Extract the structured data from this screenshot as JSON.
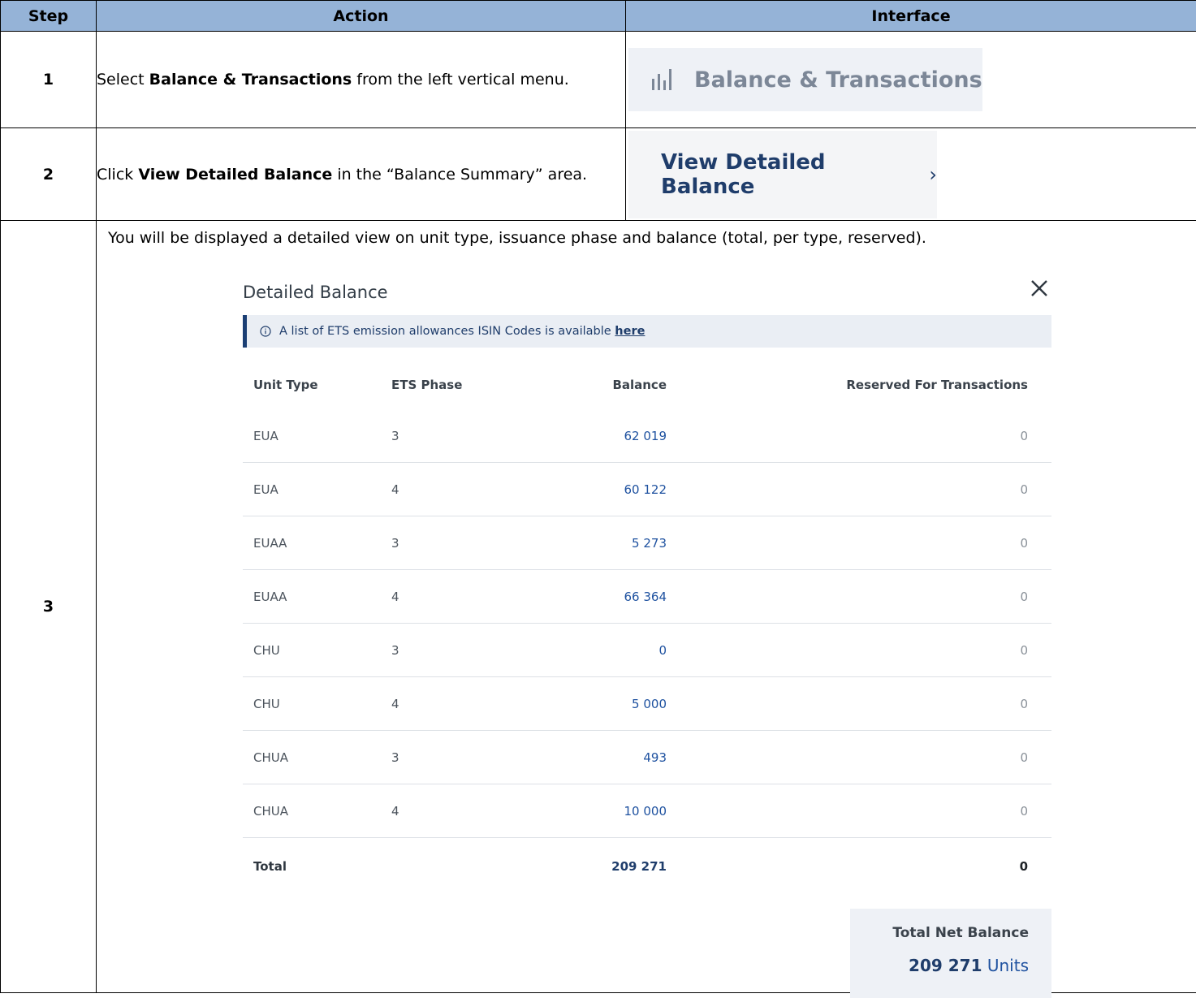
{
  "table": {
    "headers": [
      "Step",
      "Action",
      "Interface"
    ],
    "steps": [
      {
        "number": "1",
        "action_pre": "Select ",
        "action_bold": "Balance & Transactions",
        "action_post": " from the left vertical menu.",
        "interface_label": "Balance & Transactions",
        "interface_icon": "bar-chart-icon"
      },
      {
        "number": "2",
        "action_pre": "Click ",
        "action_bold": "View Detailed Balance",
        "action_post": " in the “Balance Summary” area.",
        "interface_label": "View Detailed Balance",
        "interface_icon": "chevron-right-icon"
      },
      {
        "number": "3",
        "intro": "You will be displayed a detailed view on unit type, issuance phase and balance (total, per type, reserved)."
      }
    ]
  },
  "detailed_balance": {
    "title": "Detailed Balance",
    "info_text": "A list of ETS emission allowances ISIN Codes is available ",
    "info_link": "here",
    "columns": [
      "Unit Type",
      "ETS Phase",
      "Balance",
      "Reserved For Transactions"
    ],
    "rows": [
      [
        "EUA",
        "3",
        "62 019",
        "0"
      ],
      [
        "EUA",
        "4",
        "60 122",
        "0"
      ],
      [
        "EUAA",
        "3",
        "5 273",
        "0"
      ],
      [
        "EUAA",
        "4",
        "66 364",
        "0"
      ],
      [
        "CHU",
        "3",
        "0",
        "0"
      ],
      [
        "CHU",
        "4",
        "5 000",
        "0"
      ],
      [
        "CHUA",
        "3",
        "493",
        "0"
      ],
      [
        "CHUA",
        "4",
        "10 000",
        "0"
      ]
    ],
    "total": {
      "label": "Total",
      "balance": "209 271",
      "reserved": "0"
    },
    "net": {
      "label": "Total Net Balance",
      "value": "209 271",
      "unit": "Units"
    }
  },
  "colors": {
    "header_bg": "#95b3d7",
    "accent": "#1f3d6b",
    "link": "#1f52a0"
  }
}
